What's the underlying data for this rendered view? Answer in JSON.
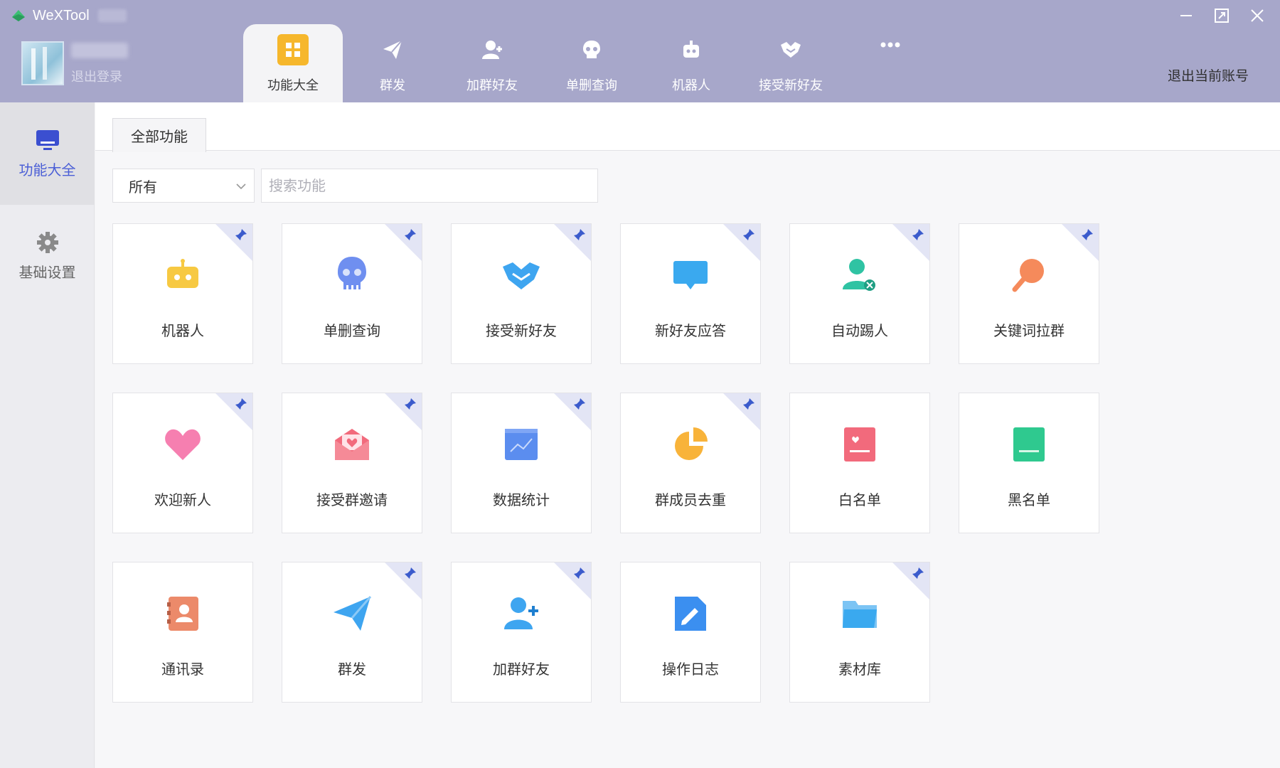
{
  "header": {
    "app_title": "WeXTool",
    "logout_link": "退出登录",
    "logout_account": "退出当前账号",
    "tabs": [
      {
        "label": "功能大全",
        "icon": "grid-icon"
      },
      {
        "label": "群发",
        "icon": "send-icon"
      },
      {
        "label": "加群好友",
        "icon": "add-friend-icon"
      },
      {
        "label": "单删查询",
        "icon": "skull-icon"
      },
      {
        "label": "机器人",
        "icon": "robot-icon"
      },
      {
        "label": "接受新好友",
        "icon": "handshake-icon"
      }
    ],
    "more_icon": "more-icon"
  },
  "sidebar": {
    "items": [
      {
        "label": "功能大全",
        "icon": "monitor-icon"
      },
      {
        "label": "基础设置",
        "icon": "gear-icon"
      }
    ]
  },
  "main": {
    "tab_label": "全部功能",
    "filter_value": "所有",
    "search_placeholder": "搜索功能",
    "cards": [
      {
        "label": "机器人",
        "icon": "robot-icon",
        "pinned": true,
        "color": "#f7c942"
      },
      {
        "label": "单删查询",
        "icon": "skull-icon",
        "pinned": true,
        "color": "#6f8ff0"
      },
      {
        "label": "接受新好友",
        "icon": "handshake-icon",
        "pinned": true,
        "color": "#3ea5f0"
      },
      {
        "label": "新好友应答",
        "icon": "chat-icon",
        "pinned": true,
        "color": "#3aa9ef"
      },
      {
        "label": "自动踢人",
        "icon": "kick-user-icon",
        "pinned": true,
        "color": "#2fc3a3"
      },
      {
        "label": "关键词拉群",
        "icon": "search-keyword-icon",
        "pinned": true,
        "color": "#f58a5b"
      },
      {
        "label": "欢迎新人",
        "icon": "heart-icon",
        "pinned": true,
        "color": "#f67fb0"
      },
      {
        "label": "接受群邀请",
        "icon": "mail-heart-icon",
        "pinned": true,
        "color": "#f26a7c"
      },
      {
        "label": "数据统计",
        "icon": "chart-icon",
        "pinned": true,
        "color": "#5b8def"
      },
      {
        "label": "群成员去重",
        "icon": "pie-icon",
        "pinned": true,
        "color": "#f8b33a"
      },
      {
        "label": "白名单",
        "icon": "whitelist-icon",
        "pinned": false,
        "color": "#f26a7c"
      },
      {
        "label": "黑名单",
        "icon": "blacklist-icon",
        "pinned": false,
        "color": "#2fc98f"
      },
      {
        "label": "通讯录",
        "icon": "contacts-icon",
        "pinned": false,
        "color": "#ec8a6a"
      },
      {
        "label": "群发",
        "icon": "send-icon",
        "pinned": true,
        "color": "#3ea5f0"
      },
      {
        "label": "加群好友",
        "icon": "add-friend-icon",
        "pinned": true,
        "color": "#3ea5f0"
      },
      {
        "label": "操作日志",
        "icon": "edit-log-icon",
        "pinned": false,
        "color": "#3b8ff0"
      },
      {
        "label": "素材库",
        "icon": "folder-icon",
        "pinned": true,
        "color": "#3aa9ef"
      }
    ]
  }
}
